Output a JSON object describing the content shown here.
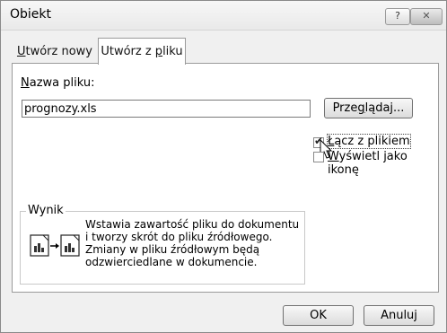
{
  "window": {
    "title": "Obiekt",
    "help_label": "?",
    "close_label": "✕"
  },
  "tabs": [
    {
      "label": "Utwórz nowy",
      "underline_char": "U",
      "rest": "twórz nowy"
    },
    {
      "label": "Utwórz z pliku",
      "pre": "Utwórz z ",
      "underline_char": "p",
      "rest": "liku"
    }
  ],
  "file": {
    "label_pre": "",
    "label_underline": "N",
    "label_rest": "azwa pliku:",
    "value": "prognozy.xls"
  },
  "browse_button": {
    "pre": "Prze",
    "underline": "g",
    "rest": "lądaj..."
  },
  "options": {
    "link": {
      "pre": "",
      "underline": "Ł",
      "rest": "ącz z plikiem",
      "checked": true
    },
    "icon": {
      "pre": "",
      "underline": "W",
      "rest": "yświetl jako ikonę",
      "checked": false
    }
  },
  "result": {
    "title": "Wynik",
    "text": "Wstawia zawartość pliku do dokumentu i tworzy skrót do pliku źródłowego. Zmiany w pliku źródłowym będą odzwierciedlane w dokumencie."
  },
  "footer": {
    "ok": "OK",
    "cancel": "Anuluj"
  }
}
